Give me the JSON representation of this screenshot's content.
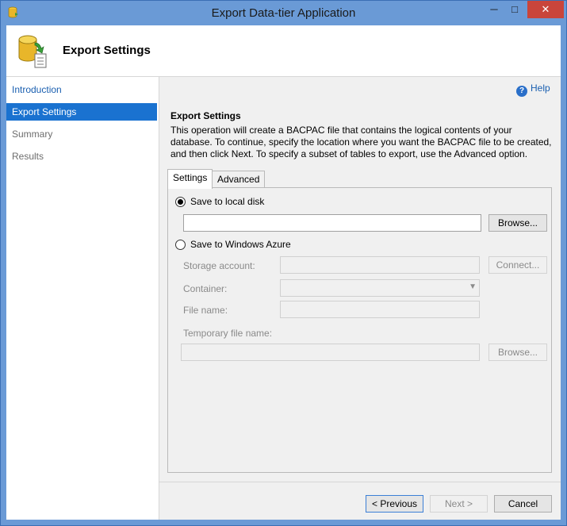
{
  "window": {
    "title": "Export Data-tier Application",
    "minimize": "─",
    "maximize": "□",
    "close": "✕",
    "app_icon": "database-export-icon"
  },
  "header": {
    "title": "Export Settings",
    "icon": "database-export-icon"
  },
  "nav": {
    "items": [
      {
        "label": "Introduction"
      },
      {
        "label": "Export Settings"
      },
      {
        "label": "Summary"
      },
      {
        "label": "Results"
      }
    ]
  },
  "help": {
    "label": "Help",
    "icon_glyph": "?"
  },
  "section": {
    "title": "Export Settings",
    "description": "This operation will create a BACPAC file that contains the logical contents of your database. To continue, specify the location where you want the BACPAC file to be created, and then click Next. To specify a subset of tables to export, use the Advanced option."
  },
  "tabs": [
    {
      "label": "Settings"
    },
    {
      "label": "Advanced"
    }
  ],
  "settings": {
    "local_disk": {
      "label": "Save to local disk",
      "selected": true,
      "path_value": "",
      "browse_label": "Browse..."
    },
    "azure": {
      "label": "Save to Windows Azure",
      "selected": false,
      "storage_account_label": "Storage account:",
      "storage_account_value": "",
      "connect_label": "Connect...",
      "container_label": "Container:",
      "container_value": "",
      "file_name_label": "File name:",
      "file_name_value": "",
      "temp_file_label": "Temporary file name:",
      "temp_file_value": "",
      "browse_label": "Browse..."
    }
  },
  "footer": {
    "previous": "< Previous",
    "next": "Next >",
    "cancel": "Cancel"
  },
  "colors": {
    "title_bar": "#6a9ad6",
    "nav_active": "#1a72d0",
    "close_button": "#c9453b",
    "link": "#1a5fb0"
  }
}
